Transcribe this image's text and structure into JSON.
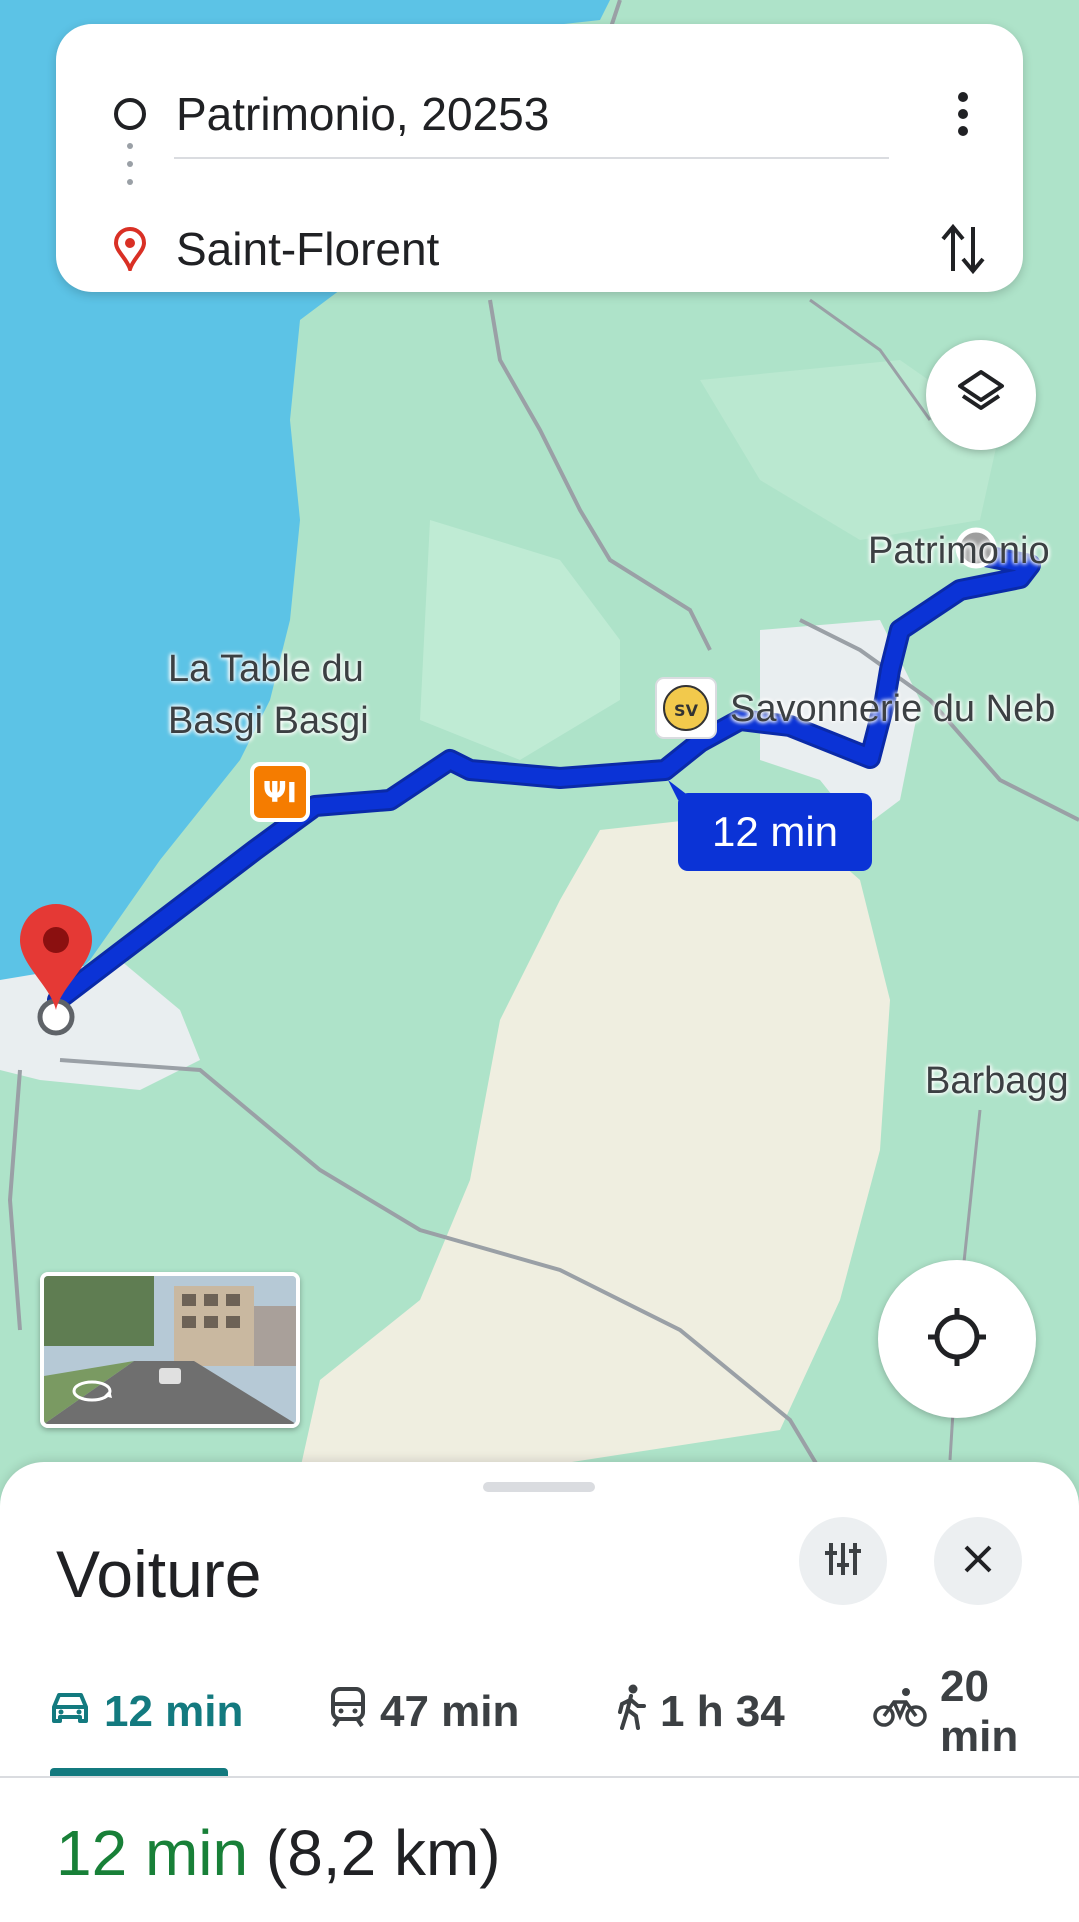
{
  "search": {
    "origin": "Patrimonio, 20253",
    "destination": "Saint-Florent"
  },
  "map": {
    "labels": {
      "patrimonio": "Patrimonio",
      "restaurant_line1": "La Table du",
      "restaurant_line2": "Basgi Basgi",
      "savonnerie": "Savonnerie du Neb",
      "barbaggio": "Barbagg"
    },
    "route_time": "12 min",
    "route_color": "#0b33d6"
  },
  "sheet": {
    "title": "Voiture",
    "modes": [
      {
        "icon": "car-icon",
        "label": "12 min",
        "active": true
      },
      {
        "icon": "transit-icon",
        "label": "47 min",
        "active": false
      },
      {
        "icon": "walk-icon",
        "label": "1 h 34",
        "active": false
      },
      {
        "icon": "bike-icon",
        "label": "20 min",
        "active": false
      }
    ],
    "summary_duration": "12 min",
    "summary_distance": "(8,2 km)"
  },
  "colors": {
    "accent": "#137a7f",
    "green_duration": "#188038",
    "pin_red": "#e53935"
  }
}
